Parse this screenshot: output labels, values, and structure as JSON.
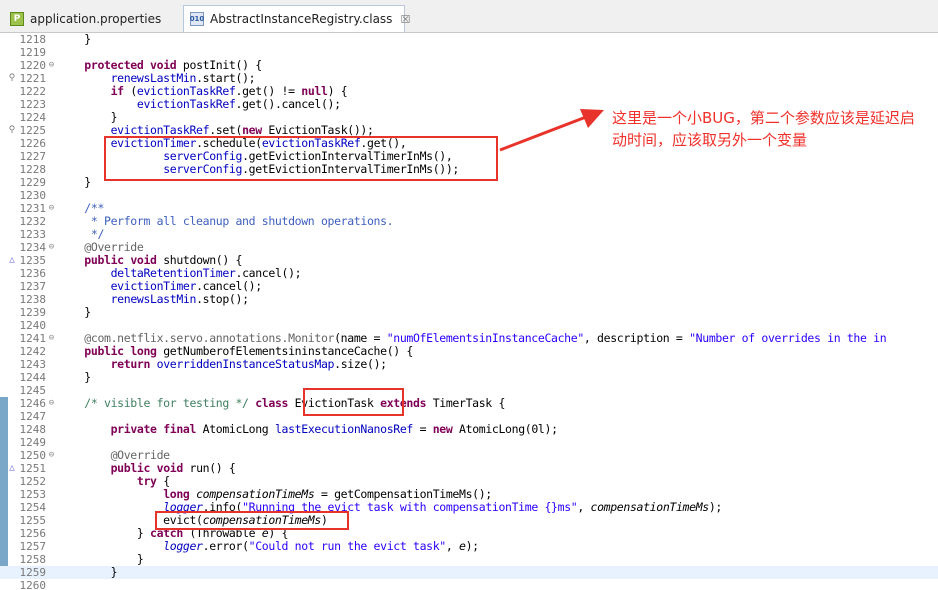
{
  "tabs": [
    {
      "label": "application.properties",
      "icon": "properties-file-icon",
      "active": false
    },
    {
      "label": "AbstractInstanceRegistry.class",
      "icon": "class-file-icon",
      "active": true,
      "close": "☒"
    }
  ],
  "lines": [
    {
      "num": "1218",
      "marker": "",
      "fold": "",
      "tokens": [
        [
          "t",
          "    }"
        ]
      ]
    },
    {
      "num": "1219",
      "marker": "",
      "fold": "",
      "tokens": []
    },
    {
      "num": "1220",
      "marker": "",
      "fold": "⊖",
      "tokens": [
        [
          "t",
          "    "
        ],
        [
          "kw",
          "protected"
        ],
        [
          "t",
          " "
        ],
        [
          "kw",
          "void"
        ],
        [
          "t",
          " postInit() {"
        ]
      ]
    },
    {
      "num": "1221",
      "marker": "⚲",
      "fold": "",
      "tokens": [
        [
          "t",
          "        "
        ],
        [
          "fld",
          "renewsLastMin"
        ],
        [
          "t",
          ".start();"
        ]
      ]
    },
    {
      "num": "1222",
      "marker": "",
      "fold": "",
      "tokens": [
        [
          "t",
          "        "
        ],
        [
          "kw",
          "if"
        ],
        [
          "t",
          " ("
        ],
        [
          "fld",
          "evictionTaskRef"
        ],
        [
          "t",
          ".get() != "
        ],
        [
          "kw",
          "null"
        ],
        [
          "t",
          ") {"
        ]
      ]
    },
    {
      "num": "1223",
      "marker": "",
      "fold": "",
      "tokens": [
        [
          "t",
          "            "
        ],
        [
          "fld",
          "evictionTaskRef"
        ],
        [
          "t",
          ".get().cancel();"
        ]
      ]
    },
    {
      "num": "1224",
      "marker": "",
      "fold": "",
      "tokens": [
        [
          "t",
          "        }"
        ]
      ]
    },
    {
      "num": "1225",
      "marker": "⚲",
      "fold": "",
      "tokens": [
        [
          "t",
          "        "
        ],
        [
          "fld",
          "evictionTaskRef"
        ],
        [
          "t",
          ".set("
        ],
        [
          "kw",
          "new"
        ],
        [
          "t",
          " EvictionTask());"
        ]
      ]
    },
    {
      "num": "1226",
      "marker": "",
      "fold": "",
      "tokens": [
        [
          "t",
          "        "
        ],
        [
          "fld",
          "evictionTimer"
        ],
        [
          "t",
          ".schedule("
        ],
        [
          "fld",
          "evictionTaskRef"
        ],
        [
          "t",
          ".get(),"
        ]
      ]
    },
    {
      "num": "1227",
      "marker": "",
      "fold": "",
      "tokens": [
        [
          "t",
          "                "
        ],
        [
          "fld",
          "serverConfig"
        ],
        [
          "t",
          ".getEvictionIntervalTimerInMs(),"
        ]
      ]
    },
    {
      "num": "1228",
      "marker": "",
      "fold": "",
      "tokens": [
        [
          "t",
          "                "
        ],
        [
          "fld",
          "serverConfig"
        ],
        [
          "t",
          ".getEvictionIntervalTimerInMs());"
        ]
      ]
    },
    {
      "num": "1229",
      "marker": "",
      "fold": "",
      "tokens": [
        [
          "t",
          "    }"
        ]
      ]
    },
    {
      "num": "1230",
      "marker": "",
      "fold": "",
      "tokens": []
    },
    {
      "num": "1231",
      "marker": "",
      "fold": "⊖",
      "tokens": [
        [
          "jd",
          "    /**"
        ]
      ]
    },
    {
      "num": "1232",
      "marker": "",
      "fold": "",
      "tokens": [
        [
          "jd",
          "     * Perform all cleanup and shutdown operations."
        ]
      ]
    },
    {
      "num": "1233",
      "marker": "",
      "fold": "",
      "tokens": [
        [
          "jd",
          "     */"
        ]
      ]
    },
    {
      "num": "1234",
      "marker": "",
      "fold": "⊖",
      "tokens": [
        [
          "ann",
          "    @Override"
        ]
      ]
    },
    {
      "num": "1235",
      "marker": "△",
      "fold": "",
      "tokens": [
        [
          "t",
          "    "
        ],
        [
          "kw",
          "public"
        ],
        [
          "t",
          " "
        ],
        [
          "kw",
          "void"
        ],
        [
          "t",
          " shutdown() {"
        ]
      ]
    },
    {
      "num": "1236",
      "marker": "",
      "fold": "",
      "tokens": [
        [
          "t",
          "        "
        ],
        [
          "fld",
          "deltaRetentionTimer"
        ],
        [
          "t",
          ".cancel();"
        ]
      ]
    },
    {
      "num": "1237",
      "marker": "",
      "fold": "",
      "tokens": [
        [
          "t",
          "        "
        ],
        [
          "fld",
          "evictionTimer"
        ],
        [
          "t",
          ".cancel();"
        ]
      ]
    },
    {
      "num": "1238",
      "marker": "",
      "fold": "",
      "tokens": [
        [
          "t",
          "        "
        ],
        [
          "fld",
          "renewsLastMin"
        ],
        [
          "t",
          ".stop();"
        ]
      ]
    },
    {
      "num": "1239",
      "marker": "",
      "fold": "",
      "tokens": [
        [
          "t",
          "    }"
        ]
      ]
    },
    {
      "num": "1240",
      "marker": "",
      "fold": "",
      "tokens": []
    },
    {
      "num": "1241",
      "marker": "",
      "fold": "⊖",
      "tokens": [
        [
          "ann",
          "    @com.netflix.servo.annotations.Monitor"
        ],
        [
          "t",
          "(name = "
        ],
        [
          "str",
          "\"numOfElementsinInstanceCache\""
        ],
        [
          "t",
          ", description = "
        ],
        [
          "str",
          "\"Number of overrides in the in"
        ]
      ]
    },
    {
      "num": "1242",
      "marker": "",
      "fold": "",
      "tokens": [
        [
          "t",
          "    "
        ],
        [
          "kw",
          "public"
        ],
        [
          "t",
          " "
        ],
        [
          "kw",
          "long"
        ],
        [
          "t",
          " getNumberofElementsininstanceCache() {"
        ]
      ]
    },
    {
      "num": "1243",
      "marker": "",
      "fold": "",
      "tokens": [
        [
          "t",
          "        "
        ],
        [
          "kw",
          "return"
        ],
        [
          "t",
          " "
        ],
        [
          "fld",
          "overriddenInstanceStatusMap"
        ],
        [
          "t",
          ".size();"
        ]
      ]
    },
    {
      "num": "1244",
      "marker": "",
      "fold": "",
      "tokens": [
        [
          "t",
          "    }"
        ]
      ]
    },
    {
      "num": "1245",
      "marker": "",
      "fold": "",
      "tokens": []
    },
    {
      "num": "1246",
      "marker": "",
      "fold": "⊖",
      "tokens": [
        [
          "cmt",
          "    /* visible for testing */"
        ],
        [
          "t",
          " "
        ],
        [
          "kw",
          "class"
        ],
        [
          "t",
          " EvictionTask "
        ],
        [
          "kw",
          "extends"
        ],
        [
          "t",
          " TimerTask {"
        ]
      ]
    },
    {
      "num": "1247",
      "marker": "",
      "fold": "",
      "tokens": []
    },
    {
      "num": "1248",
      "marker": "",
      "fold": "",
      "tokens": [
        [
          "t",
          "        "
        ],
        [
          "kw",
          "private"
        ],
        [
          "t",
          " "
        ],
        [
          "kw",
          "final"
        ],
        [
          "t",
          " AtomicLong "
        ],
        [
          "fld",
          "lastExecutionNanosRef"
        ],
        [
          "t",
          " = "
        ],
        [
          "kw",
          "new"
        ],
        [
          "t",
          " AtomicLong(0l);"
        ]
      ]
    },
    {
      "num": "1249",
      "marker": "",
      "fold": "",
      "tokens": []
    },
    {
      "num": "1250",
      "marker": "",
      "fold": "⊖",
      "tokens": [
        [
          "ann",
          "        @Override"
        ]
      ]
    },
    {
      "num": "1251",
      "marker": "△",
      "fold": "",
      "tokens": [
        [
          "t",
          "        "
        ],
        [
          "kw",
          "public"
        ],
        [
          "t",
          " "
        ],
        [
          "kw",
          "void"
        ],
        [
          "t",
          " run() {"
        ]
      ]
    },
    {
      "num": "1252",
      "marker": "",
      "fold": "",
      "tokens": [
        [
          "t",
          "            "
        ],
        [
          "kw",
          "try"
        ],
        [
          "t",
          " {"
        ]
      ]
    },
    {
      "num": "1253",
      "marker": "",
      "fold": "",
      "tokens": [
        [
          "t",
          "                "
        ],
        [
          "kw",
          "long"
        ],
        [
          "t",
          " "
        ],
        [
          "it",
          "compensationTimeMs"
        ],
        [
          "t",
          " = getCompensationTimeMs();"
        ]
      ]
    },
    {
      "num": "1254",
      "marker": "",
      "fold": "",
      "tokens": [
        [
          "t",
          "                "
        ],
        [
          "fldit",
          "logger"
        ],
        [
          "t",
          ".info("
        ],
        [
          "str",
          "\"Running the evict task with compensationTime {}ms\""
        ],
        [
          "t",
          ", "
        ],
        [
          "it",
          "compensationTimeMs"
        ],
        [
          "t",
          ");"
        ]
      ]
    },
    {
      "num": "1255",
      "marker": "",
      "fold": "",
      "tokens": [
        [
          "t",
          "                evict("
        ],
        [
          "it",
          "compensationTimeMs"
        ],
        [
          "t",
          ")"
        ]
      ]
    },
    {
      "num": "1256",
      "marker": "",
      "fold": "",
      "tokens": [
        [
          "t",
          "            } "
        ],
        [
          "kw",
          "catch"
        ],
        [
          "t",
          " (Throwable "
        ],
        [
          "it",
          "e"
        ],
        [
          "t",
          ") {"
        ]
      ]
    },
    {
      "num": "1257",
      "marker": "",
      "fold": "",
      "tokens": [
        [
          "t",
          "                "
        ],
        [
          "fldit",
          "logger"
        ],
        [
          "t",
          ".error("
        ],
        [
          "str",
          "\"Could not run the evict task\""
        ],
        [
          "t",
          ", "
        ],
        [
          "it",
          "e"
        ],
        [
          "t",
          ");"
        ]
      ]
    },
    {
      "num": "1258",
      "marker": "",
      "fold": "",
      "tokens": [
        [
          "t",
          "            }"
        ]
      ]
    },
    {
      "num": "1259",
      "marker": "",
      "fold": "",
      "tokens": [
        [
          "t",
          "        }"
        ]
      ]
    },
    {
      "num": "1260",
      "marker": "",
      "fold": "",
      "tokens": []
    }
  ],
  "annotation": {
    "line1": "这里是一个小BUG，第二个参数应该是延迟启",
    "line2": "动时间，应该取另外一个变量"
  },
  "colors": {
    "keyword": "#7f0055",
    "field": "#0000c0",
    "string": "#2a00ff",
    "comment": "#3f7f5f",
    "javadoc": "#3f5fbf",
    "annotation": "#646464",
    "highlight": "#e8332a",
    "current_line": "#e8f2fe"
  }
}
